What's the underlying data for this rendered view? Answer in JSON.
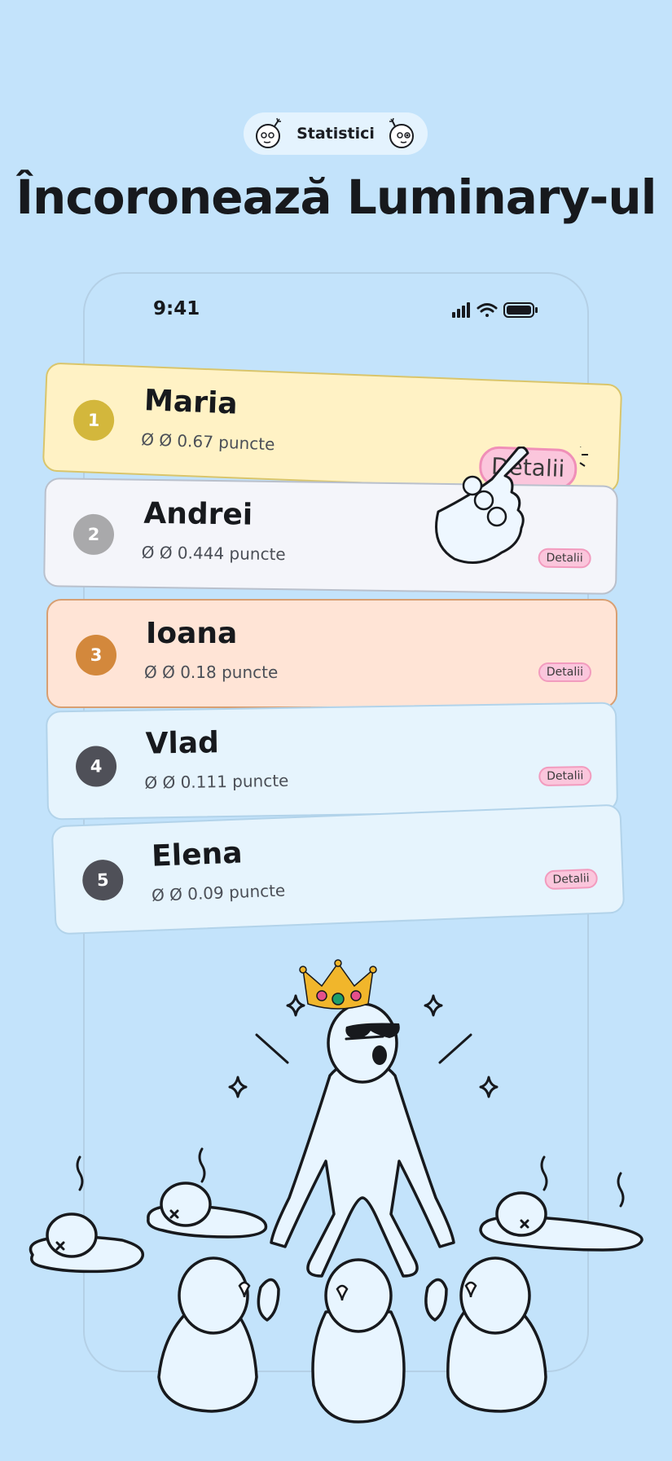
{
  "header": {
    "pill_label": "Statistici",
    "headline": "Încoronează Luminary-ul"
  },
  "phone": {
    "time": "9:41"
  },
  "leaderboard": [
    {
      "rank": "1",
      "name": "Maria",
      "score": "Ø Ø 0.67 puncte",
      "details": "Detalii",
      "rank_color": "#d3b73c"
    },
    {
      "rank": "2",
      "name": "Andrei",
      "score": "Ø Ø 0.444 puncte",
      "details": "Detalii",
      "rank_color": "#a9a9ab"
    },
    {
      "rank": "3",
      "name": "Ioana",
      "score": "Ø Ø 0.18 puncte",
      "details": "Detalii",
      "rank_color": "#d3883c"
    },
    {
      "rank": "4",
      "name": "Vlad",
      "score": "Ø Ø 0.111 puncte",
      "details": "Detalii",
      "rank_color": "#4f5058"
    },
    {
      "rank": "5",
      "name": "Elena",
      "score": "Ø Ø 0.09 puncte",
      "details": "Detalii",
      "rank_color": "#4f5058"
    }
  ],
  "icons": [
    "bomb-face-icon",
    "signal-icon",
    "wifi-icon",
    "battery-icon",
    "pointing-hand-icon",
    "crown-icon",
    "sparkle-icon"
  ],
  "colors": {
    "background": "#c3e3fb",
    "details_pink": "#fbc6dc",
    "card_gold": "#fff2c5",
    "card_silver": "#f4f5fa",
    "card_bronze": "#ffe4d6",
    "card_blue": "#e6f4fd"
  }
}
